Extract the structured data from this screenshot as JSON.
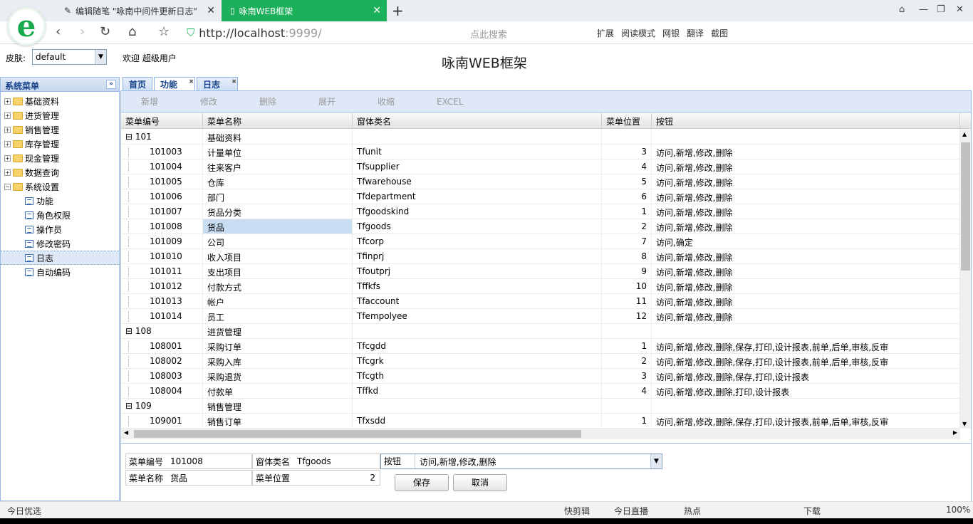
{
  "browser": {
    "tabs": [
      {
        "label": "编辑随笔 \"咏南中间件更新日志\""
      },
      {
        "label": "咏南WEB框架"
      }
    ],
    "url_host": "http://localhost",
    "url_port": ":9999/",
    "search_placeholder": "点此搜索",
    "tools": [
      "扩展",
      "阅读模式",
      "网银",
      "翻译",
      "截图"
    ]
  },
  "header": {
    "skin_label": "皮肤:",
    "skin_value": "default",
    "welcome": "欢迎 超级用户",
    "title": "咏南WEB框架"
  },
  "sidebar": {
    "title": "系统菜单",
    "items": [
      {
        "label": "基础资料",
        "type": "folder"
      },
      {
        "label": "进货管理",
        "type": "folder"
      },
      {
        "label": "销售管理",
        "type": "folder"
      },
      {
        "label": "库存管理",
        "type": "folder"
      },
      {
        "label": "现金管理",
        "type": "folder"
      },
      {
        "label": "数据查询",
        "type": "folder"
      },
      {
        "label": "系统设置",
        "type": "folder-open"
      },
      {
        "label": "功能",
        "type": "doc"
      },
      {
        "label": "角色权限",
        "type": "doc"
      },
      {
        "label": "操作员",
        "type": "doc"
      },
      {
        "label": "修改密码",
        "type": "doc"
      },
      {
        "label": "日志",
        "type": "doc"
      },
      {
        "label": "自动编码",
        "type": "doc"
      }
    ]
  },
  "tabs": [
    "首页",
    "功能",
    "日志"
  ],
  "toolbar": [
    "新增",
    "修改",
    "删除",
    "展开",
    "收缩",
    "EXCEL"
  ],
  "grid": {
    "columns": [
      "菜单编号",
      "菜单名称",
      "窗体类名",
      "菜单位置",
      "按钮"
    ],
    "rows": [
      {
        "id": "101",
        "name": "基础资料",
        "cls": "",
        "pos": "",
        "btn": "",
        "group": true
      },
      {
        "id": "101003",
        "name": "计量单位",
        "cls": "Tfunit",
        "pos": "3",
        "btn": "访问,新增,修改,删除"
      },
      {
        "id": "101004",
        "name": "往来客户",
        "cls": "Tfsupplier",
        "pos": "4",
        "btn": "访问,新增,修改,删除"
      },
      {
        "id": "101005",
        "name": "仓库",
        "cls": "Tfwarehouse",
        "pos": "5",
        "btn": "访问,新增,修改,删除"
      },
      {
        "id": "101006",
        "name": "部门",
        "cls": "Tfdepartment",
        "pos": "6",
        "btn": "访问,新增,修改,删除"
      },
      {
        "id": "101007",
        "name": "货品分类",
        "cls": "Tfgoodskind",
        "pos": "1",
        "btn": "访问,新增,修改,删除"
      },
      {
        "id": "101008",
        "name": "货品",
        "cls": "Tfgoods",
        "pos": "2",
        "btn": "访问,新增,修改,删除",
        "selected": true
      },
      {
        "id": "101009",
        "name": "公司",
        "cls": "Tfcorp",
        "pos": "7",
        "btn": "访问,确定"
      },
      {
        "id": "101010",
        "name": "收入项目",
        "cls": "Tfinprj",
        "pos": "8",
        "btn": "访问,新增,修改,删除"
      },
      {
        "id": "101011",
        "name": "支出项目",
        "cls": "Tfoutprj",
        "pos": "9",
        "btn": "访问,新增,修改,删除"
      },
      {
        "id": "101012",
        "name": "付款方式",
        "cls": "Tffkfs",
        "pos": "10",
        "btn": "访问,新增,修改,删除"
      },
      {
        "id": "101013",
        "name": "帐户",
        "cls": "Tfaccount",
        "pos": "11",
        "btn": "访问,新增,修改,删除"
      },
      {
        "id": "101014",
        "name": "员工",
        "cls": "Tfempolyee",
        "pos": "12",
        "btn": "访问,新增,修改,删除"
      },
      {
        "id": "108",
        "name": "进货管理",
        "cls": "",
        "pos": "",
        "btn": "",
        "group": true
      },
      {
        "id": "108001",
        "name": "采购订单",
        "cls": "Tfcgdd",
        "pos": "1",
        "btn": "访问,新增,修改,删除,保存,打印,设计报表,前单,后单,审核,反审"
      },
      {
        "id": "108002",
        "name": "采购入库",
        "cls": "Tfcgrk",
        "pos": "2",
        "btn": "访问,新增,修改,删除,保存,打印,设计报表,前单,后单,审核,反审"
      },
      {
        "id": "108003",
        "name": "采购退货",
        "cls": "Tfcgth",
        "pos": "3",
        "btn": "访问,新增,修改,删除,保存,打印,设计报表"
      },
      {
        "id": "108004",
        "name": "付款单",
        "cls": "Tffkd",
        "pos": "4",
        "btn": "访问,新增,修改,删除,打印,设计报表"
      },
      {
        "id": "109",
        "name": "销售管理",
        "cls": "",
        "pos": "",
        "btn": "",
        "group": true
      },
      {
        "id": "109001",
        "name": "销售订单",
        "cls": "Tfxsdd",
        "pos": "1",
        "btn": "访问,新增,修改,删除,保存,打印,设计报表,前单,后单,审核,反审"
      }
    ]
  },
  "form": {
    "id_label": "菜单编号",
    "id_value": "101008",
    "cls_label": "窗体类名",
    "cls_value": "Tfgoods",
    "btn_label": "按钮",
    "btn_value": "访问,新增,修改,删除",
    "name_label": "菜单名称",
    "name_value": "货品",
    "pos_label": "菜单位置",
    "pos_value": "2",
    "save": "保存",
    "cancel": "取消"
  },
  "status": {
    "left": "今日优选",
    "items": [
      "快剪辑",
      "今日直播",
      "热点",
      "下载"
    ],
    "zoom": "100%"
  }
}
